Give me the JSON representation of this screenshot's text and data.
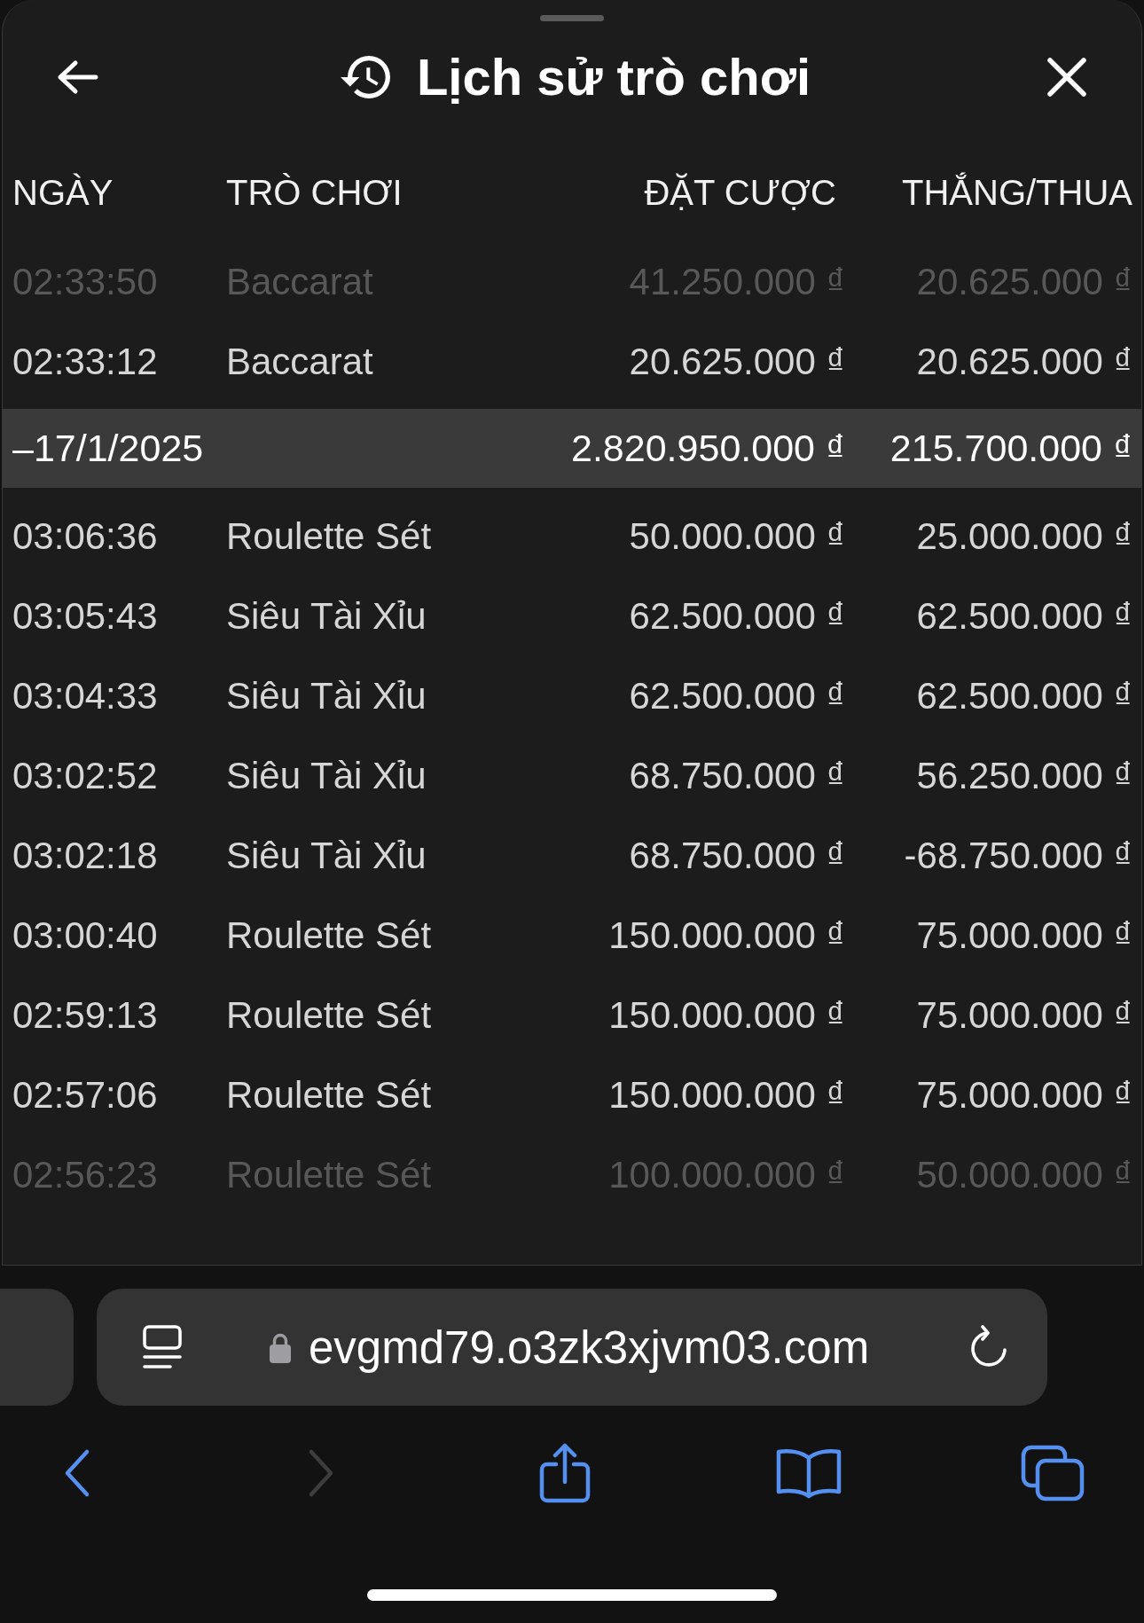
{
  "sheet": {
    "title": "Lịch sử trò chơi"
  },
  "table": {
    "columns": [
      "NGÀY",
      "TRÒ CHƠI",
      "ĐẶT CƯỢC",
      "THẮNG/THUA"
    ],
    "rows": [
      {
        "kind": "entry",
        "time": "02:33:50",
        "game": "Baccarat",
        "bet": "41.250.000 ₫",
        "result": "20.625.000 ₫",
        "faded": true
      },
      {
        "kind": "entry",
        "time": "02:33:12",
        "game": "Baccarat",
        "bet": "20.625.000 ₫",
        "result": "20.625.000 ₫",
        "faded": false
      },
      {
        "kind": "date",
        "date": "–17/1/2025",
        "bet": "2.820.950.000 ₫",
        "result": "215.700.000 ₫"
      },
      {
        "kind": "entry",
        "time": "03:06:36",
        "game": "Roulette Sét",
        "bet": "50.000.000 ₫",
        "result": "25.000.000 ₫",
        "faded": false
      },
      {
        "kind": "entry",
        "time": "03:05:43",
        "game": "Siêu Tài Xỉu",
        "bet": "62.500.000 ₫",
        "result": "62.500.000 ₫",
        "faded": false
      },
      {
        "kind": "entry",
        "time": "03:04:33",
        "game": "Siêu Tài Xỉu",
        "bet": "62.500.000 ₫",
        "result": "62.500.000 ₫",
        "faded": false
      },
      {
        "kind": "entry",
        "time": "03:02:52",
        "game": "Siêu Tài Xỉu",
        "bet": "68.750.000 ₫",
        "result": "56.250.000 ₫",
        "faded": false
      },
      {
        "kind": "entry",
        "time": "03:02:18",
        "game": "Siêu Tài Xỉu",
        "bet": "68.750.000 ₫",
        "result": "-68.750.000 ₫",
        "faded": false
      },
      {
        "kind": "entry",
        "time": "03:00:40",
        "game": "Roulette Sét",
        "bet": "150.000.000 ₫",
        "result": "75.000.000 ₫",
        "faded": false
      },
      {
        "kind": "entry",
        "time": "02:59:13",
        "game": "Roulette Sét",
        "bet": "150.000.000 ₫",
        "result": "75.000.000 ₫",
        "faded": false
      },
      {
        "kind": "entry",
        "time": "02:57:06",
        "game": "Roulette Sét",
        "bet": "150.000.000 ₫",
        "result": "75.000.000 ₫",
        "faded": false
      },
      {
        "kind": "entry",
        "time": "02:56:23",
        "game": "Roulette Sét",
        "bet": "100.000.000 ₫",
        "result": "50.000.000 ₫",
        "faded": true
      }
    ]
  },
  "browser": {
    "url": "evgmd79.o3zk3xjvm03.com",
    "toolbar": [
      {
        "kind": "back",
        "disabled": false
      },
      {
        "kind": "forward",
        "disabled": true
      },
      {
        "kind": "share",
        "disabled": false
      },
      {
        "kind": "bookmarks",
        "disabled": false
      },
      {
        "kind": "tabs",
        "disabled": false
      }
    ]
  }
}
